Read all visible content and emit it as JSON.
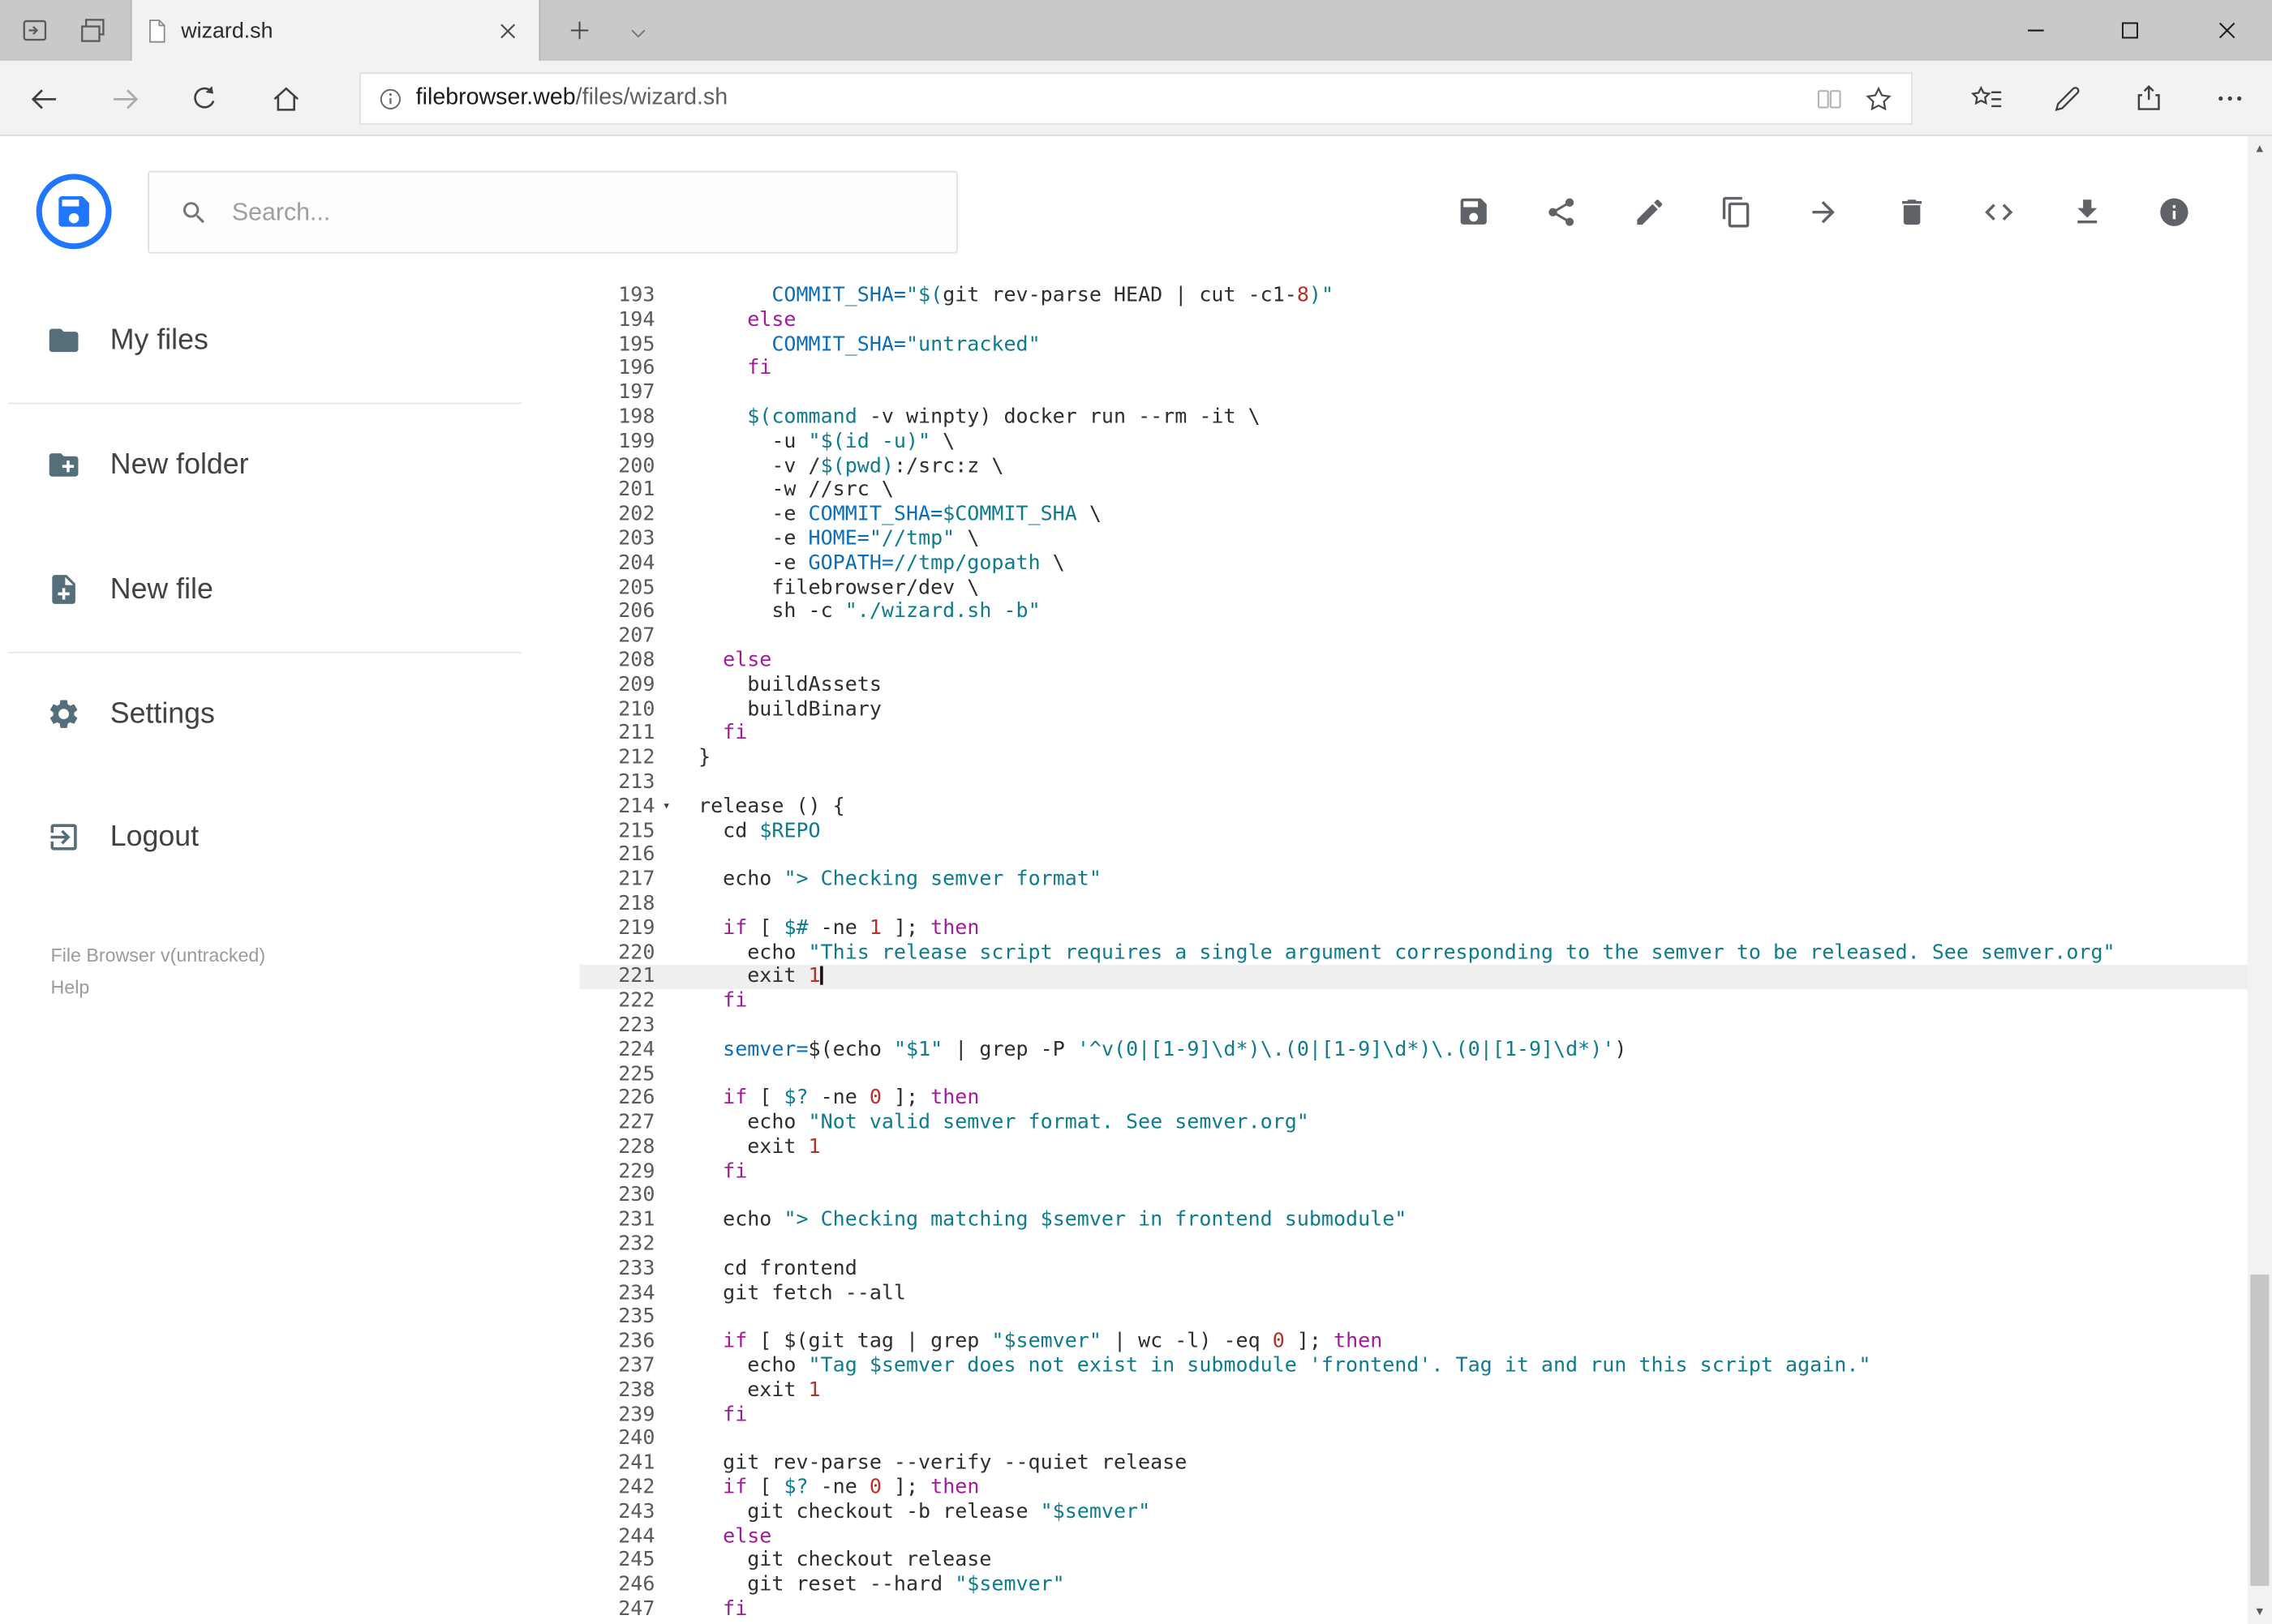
{
  "browser": {
    "tab_title": "wizard.sh",
    "url": {
      "domain": "filebrowser.web",
      "path": "/files/wizard.sh"
    },
    "window_controls": [
      "minimize",
      "maximize",
      "close"
    ],
    "nav_icons": [
      "back",
      "forward",
      "refresh",
      "home"
    ],
    "address_icons": [
      "info",
      "reading-view",
      "favorite-star"
    ],
    "right_icons": [
      "hub",
      "web-note-pen",
      "share",
      "more"
    ]
  },
  "header": {
    "search_placeholder": "Search...",
    "toolbar_icons": [
      "save",
      "share",
      "rename",
      "copy",
      "move",
      "delete",
      "code-view",
      "download",
      "info"
    ],
    "accent_color": "#2176ff"
  },
  "sidebar": {
    "items": [
      {
        "icon": "folder-icon",
        "label": "My files"
      },
      {
        "icon": "new-folder-icon",
        "label": "New folder"
      },
      {
        "icon": "new-file-icon",
        "label": "New file"
      },
      {
        "icon": "settings-icon",
        "label": "Settings"
      },
      {
        "icon": "logout-icon",
        "label": "Logout"
      }
    ],
    "footer": {
      "version": "File Browser v(untracked)",
      "help": "Help"
    }
  },
  "editor": {
    "active_line": 221,
    "fold_line": 214,
    "syntax_colors": {
      "default": "#2e2e2e",
      "keyword": "#a11b9b",
      "string": "#0e7c8c",
      "variable": "#0d6eb8",
      "number": "#b5312a"
    },
    "lines": [
      {
        "n": 193,
        "t": [
          [
            "d",
            "      "
          ],
          [
            "v",
            "COMMIT_SHA="
          ],
          [
            "s",
            "\"$("
          ],
          [
            "d",
            "git rev-parse HEAD | cut -c1-"
          ],
          [
            "n",
            "8"
          ],
          [
            "s",
            ")\""
          ]
        ]
      },
      {
        "n": 194,
        "t": [
          [
            "d",
            "    "
          ],
          [
            "k",
            "else"
          ]
        ]
      },
      {
        "n": 195,
        "t": [
          [
            "d",
            "      "
          ],
          [
            "v",
            "COMMIT_SHA="
          ],
          [
            "s",
            "\"untracked\""
          ]
        ]
      },
      {
        "n": 196,
        "t": [
          [
            "d",
            "    "
          ],
          [
            "k",
            "fi"
          ]
        ]
      },
      {
        "n": 197,
        "t": []
      },
      {
        "n": 198,
        "t": [
          [
            "d",
            "    "
          ],
          [
            "s",
            "$(command"
          ],
          [
            "d",
            " -v winpty) docker run --rm -it \\"
          ]
        ]
      },
      {
        "n": 199,
        "t": [
          [
            "d",
            "      -u "
          ],
          [
            "s",
            "\"$(id -u)\""
          ],
          [
            "d",
            " \\"
          ]
        ]
      },
      {
        "n": 200,
        "t": [
          [
            "d",
            "      -v /"
          ],
          [
            "s",
            "$(pwd)"
          ],
          [
            "d",
            ":/src:z \\"
          ]
        ]
      },
      {
        "n": 201,
        "t": [
          [
            "d",
            "      -w //src \\"
          ]
        ]
      },
      {
        "n": 202,
        "t": [
          [
            "d",
            "      -e "
          ],
          [
            "v",
            "COMMIT_SHA="
          ],
          [
            "s",
            "$COMMIT_SHA"
          ],
          [
            "d",
            " \\"
          ]
        ]
      },
      {
        "n": 203,
        "t": [
          [
            "d",
            "      -e "
          ],
          [
            "v",
            "HOME="
          ],
          [
            "s",
            "\"//tmp\""
          ],
          [
            "d",
            " \\"
          ]
        ]
      },
      {
        "n": 204,
        "t": [
          [
            "d",
            "      -e "
          ],
          [
            "v",
            "GOPATH="
          ],
          [
            "s",
            "//tmp/gopath"
          ],
          [
            "d",
            " \\"
          ]
        ]
      },
      {
        "n": 205,
        "t": [
          [
            "d",
            "      filebrowser/dev \\"
          ]
        ]
      },
      {
        "n": 206,
        "t": [
          [
            "d",
            "      sh -c "
          ],
          [
            "s",
            "\"./wizard.sh -b\""
          ]
        ]
      },
      {
        "n": 207,
        "t": []
      },
      {
        "n": 208,
        "t": [
          [
            "d",
            "  "
          ],
          [
            "k",
            "else"
          ]
        ]
      },
      {
        "n": 209,
        "t": [
          [
            "d",
            "    buildAssets"
          ]
        ]
      },
      {
        "n": 210,
        "t": [
          [
            "d",
            "    buildBinary"
          ]
        ]
      },
      {
        "n": 211,
        "t": [
          [
            "d",
            "  "
          ],
          [
            "k",
            "fi"
          ]
        ]
      },
      {
        "n": 212,
        "t": [
          [
            "d",
            "}"
          ]
        ]
      },
      {
        "n": 213,
        "t": []
      },
      {
        "n": 214,
        "t": [
          [
            "d",
            "release () {"
          ]
        ]
      },
      {
        "n": 215,
        "t": [
          [
            "d",
            "  cd "
          ],
          [
            "s",
            "$REPO"
          ]
        ]
      },
      {
        "n": 216,
        "t": []
      },
      {
        "n": 217,
        "t": [
          [
            "d",
            "  echo "
          ],
          [
            "s",
            "\"> Checking semver format\""
          ]
        ]
      },
      {
        "n": 218,
        "t": []
      },
      {
        "n": 219,
        "t": [
          [
            "d",
            "  "
          ],
          [
            "k",
            "if"
          ],
          [
            "d",
            " [ "
          ],
          [
            "s",
            "$#"
          ],
          [
            "d",
            " -ne "
          ],
          [
            "n",
            "1"
          ],
          [
            "d",
            " ]; "
          ],
          [
            "k",
            "then"
          ]
        ]
      },
      {
        "n": 220,
        "t": [
          [
            "d",
            "    echo "
          ],
          [
            "s",
            "\"This release script requires a single argument corresponding to the semver to be released. See semver.org\""
          ]
        ]
      },
      {
        "n": 221,
        "t": [
          [
            "d",
            "    exit "
          ],
          [
            "n",
            "1"
          ]
        ]
      },
      {
        "n": 222,
        "t": [
          [
            "d",
            "  "
          ],
          [
            "k",
            "fi"
          ]
        ]
      },
      {
        "n": 223,
        "t": []
      },
      {
        "n": 224,
        "t": [
          [
            "d",
            "  "
          ],
          [
            "v",
            "semver="
          ],
          [
            "d",
            "$(echo "
          ],
          [
            "s",
            "\"$1\""
          ],
          [
            "d",
            " | grep -P "
          ],
          [
            "s",
            "'^v(0|[1-9]\\d*)\\.(0|[1-9]\\d*)\\.(0|[1-9]\\d*)'"
          ],
          [
            "d",
            ")"
          ]
        ]
      },
      {
        "n": 225,
        "t": []
      },
      {
        "n": 226,
        "t": [
          [
            "d",
            "  "
          ],
          [
            "k",
            "if"
          ],
          [
            "d",
            " [ "
          ],
          [
            "s",
            "$?"
          ],
          [
            "d",
            " -ne "
          ],
          [
            "n",
            "0"
          ],
          [
            "d",
            " ]; "
          ],
          [
            "k",
            "then"
          ]
        ]
      },
      {
        "n": 227,
        "t": [
          [
            "d",
            "    echo "
          ],
          [
            "s",
            "\"Not valid semver format. See semver.org\""
          ]
        ]
      },
      {
        "n": 228,
        "t": [
          [
            "d",
            "    exit "
          ],
          [
            "n",
            "1"
          ]
        ]
      },
      {
        "n": 229,
        "t": [
          [
            "d",
            "  "
          ],
          [
            "k",
            "fi"
          ]
        ]
      },
      {
        "n": 230,
        "t": []
      },
      {
        "n": 231,
        "t": [
          [
            "d",
            "  echo "
          ],
          [
            "s",
            "\"> Checking matching $semver in frontend submodule\""
          ]
        ]
      },
      {
        "n": 232,
        "t": []
      },
      {
        "n": 233,
        "t": [
          [
            "d",
            "  cd frontend"
          ]
        ]
      },
      {
        "n": 234,
        "t": [
          [
            "d",
            "  git fetch --all"
          ]
        ]
      },
      {
        "n": 235,
        "t": []
      },
      {
        "n": 236,
        "t": [
          [
            "d",
            "  "
          ],
          [
            "k",
            "if"
          ],
          [
            "d",
            " [ $(git tag | grep "
          ],
          [
            "s",
            "\"$semver\""
          ],
          [
            "d",
            " | wc -l) -eq "
          ],
          [
            "n",
            "0"
          ],
          [
            "d",
            " ]; "
          ],
          [
            "k",
            "then"
          ]
        ]
      },
      {
        "n": 237,
        "t": [
          [
            "d",
            "    echo "
          ],
          [
            "s",
            "\"Tag $semver does not exist in submodule 'frontend'. Tag it and run this script again.\""
          ]
        ]
      },
      {
        "n": 238,
        "t": [
          [
            "d",
            "    exit "
          ],
          [
            "n",
            "1"
          ]
        ]
      },
      {
        "n": 239,
        "t": [
          [
            "d",
            "  "
          ],
          [
            "k",
            "fi"
          ]
        ]
      },
      {
        "n": 240,
        "t": []
      },
      {
        "n": 241,
        "t": [
          [
            "d",
            "  git rev-parse --verify --quiet release"
          ]
        ]
      },
      {
        "n": 242,
        "t": [
          [
            "d",
            "  "
          ],
          [
            "k",
            "if"
          ],
          [
            "d",
            " [ "
          ],
          [
            "s",
            "$?"
          ],
          [
            "d",
            " -ne "
          ],
          [
            "n",
            "0"
          ],
          [
            "d",
            " ]; "
          ],
          [
            "k",
            "then"
          ]
        ]
      },
      {
        "n": 243,
        "t": [
          [
            "d",
            "    git checkout -b release "
          ],
          [
            "s",
            "\"$semver\""
          ]
        ]
      },
      {
        "n": 244,
        "t": [
          [
            "d",
            "  "
          ],
          [
            "k",
            "else"
          ]
        ]
      },
      {
        "n": 245,
        "t": [
          [
            "d",
            "    git checkout release"
          ]
        ]
      },
      {
        "n": 246,
        "t": [
          [
            "d",
            "    git reset --hard "
          ],
          [
            "s",
            "\"$semver\""
          ]
        ]
      },
      {
        "n": 247,
        "t": [
          [
            "d",
            "  "
          ],
          [
            "k",
            "fi"
          ]
        ]
      }
    ]
  }
}
